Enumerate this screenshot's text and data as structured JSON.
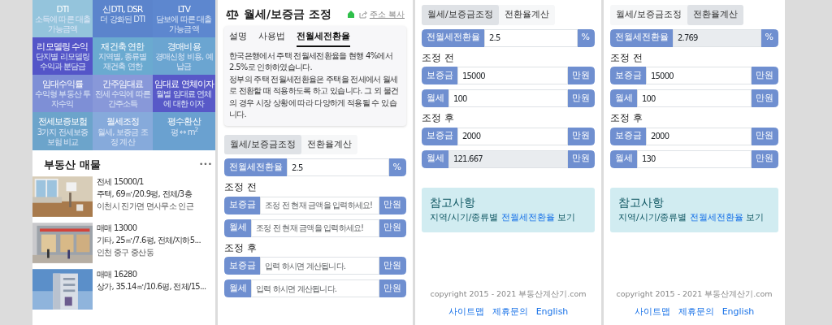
{
  "menu_panel": {
    "tiles": [
      {
        "title": "DTI",
        "desc": "소득에 따른 대출 가능금액",
        "color": "#94c4dc"
      },
      {
        "title": "신DTI, DSR",
        "desc": "더 강화된 DTI",
        "color": "#5b84cc"
      },
      {
        "title": "LTV",
        "desc": "담보에 따른 대출 가능금액",
        "color": "#5d87cf"
      },
      {
        "title": "리모델링 수익",
        "desc": "단지별 리모델링 수익과 분담금",
        "color": "#5455c8"
      },
      {
        "title": "재건축 연한",
        "desc": "지역별, 종류별 재건축 연한",
        "color": "#6aaad0"
      },
      {
        "title": "경매비용",
        "desc": "경매신청 비용, 예납금",
        "color": "#6ba5d1"
      },
      {
        "title": "임대수익률",
        "desc": "수익형 부동산 투자수익",
        "color": "#7e8fd6"
      },
      {
        "title": "간주임대료",
        "desc": "전세 수익에 따른 간주소득",
        "color": "#8898d9"
      },
      {
        "title": "임대료 연체이자",
        "desc": "월별 임대료 연체에 대한 이자",
        "color": "#5859c8"
      },
      {
        "title": "전세보증보험",
        "desc": "3가지 전세보증보험 비교",
        "color": "#6ca4cb"
      },
      {
        "title": "월세조정",
        "desc": "월세, 보증금 조정 계산",
        "color": "#86aadb"
      },
      {
        "title": "평수환산",
        "desc": "평 ↔ m$^{2}$",
        "color": "#6aa1d0"
      }
    ],
    "listings": {
      "title": "부동산 매물",
      "more": "•••",
      "items": [
        {
          "headline": "전세 15000/1",
          "details": "주택, 69㎡/20.9평, 전체/3층",
          "location": "이천시 진가면 면사무소 인근"
        },
        {
          "headline": "매매 13000",
          "details": "기타, 25㎡/7.6평, 전체/지하5...",
          "location": "인천 중구 중산동"
        },
        {
          "headline": "매매 16280",
          "details": "상가, 35.14㎡/10.6평, 전체/15..."
        }
      ]
    }
  },
  "calculators": [
    {
      "header": {
        "title": "월세/보증금 조정",
        "copy_label": "주소 복사"
      },
      "info": {
        "tabs": [
          {
            "label": "설명",
            "selected": false
          },
          {
            "label": "사용법",
            "selected": false
          },
          {
            "label": "전월세전환율",
            "selected": true
          }
        ],
        "paragraphs": [
          "한국은행에서 주택 전월세전환율을 현행 4%에서 2.5%로 인하하였습니다.",
          "정부의 주택 전월세전환율은 주택을 전세에서 월세로 전환할 때 적용하도록 하고 있습니다. 그 외 물건의 경우 시장 상황에 따라 다양하게 적용될 수 있습니다."
        ]
      },
      "modes": [
        {
          "label": "월세/보증금조정",
          "selected": true
        },
        {
          "label": "전환율계산",
          "selected": false
        }
      ],
      "rate": {
        "label": "전월세전환율",
        "value": "2.5",
        "unit": "%",
        "readonly": false
      },
      "sections": [
        {
          "heading": "조정 전",
          "fields": [
            {
              "label": "보증금",
              "placeholder": "조정 전 현재 금액을 입력하세요!",
              "unit": "만원",
              "readonly": false
            },
            {
              "label": "월세",
              "placeholder": "조정 전 현재 금액을 입력하세요!",
              "unit": "만원",
              "readonly": false
            }
          ]
        },
        {
          "heading": "조정 후",
          "fields": [
            {
              "label": "보증금",
              "placeholder": "입력 하시면 계산됩니다.",
              "unit": "만원",
              "readonly": false
            },
            {
              "label": "월세",
              "placeholder": "입력 하시면 계산됩니다.",
              "unit": "만원",
              "readonly": false
            }
          ]
        }
      ]
    },
    {
      "modes": [
        {
          "label": "월세/보증금조정",
          "selected": true
        },
        {
          "label": "전환율계산",
          "selected": false
        }
      ],
      "rate": {
        "label": "전월세전환율",
        "value": "2.5",
        "unit": "%",
        "readonly": false
      },
      "sections": [
        {
          "heading": "조정 전",
          "fields": [
            {
              "label": "보증금",
              "value": "15000",
              "unit": "만원",
              "readonly": false
            },
            {
              "label": "월세",
              "value": "100",
              "unit": "만원",
              "readonly": false
            }
          ]
        },
        {
          "heading": "조정 후",
          "fields": [
            {
              "label": "보증금",
              "value": "2000",
              "unit": "만원",
              "readonly": false
            },
            {
              "label": "월세",
              "value": "121.667",
              "unit": "만원",
              "readonly": true
            }
          ]
        }
      ],
      "notice": {
        "title": "참고사항",
        "text_before": "지역/시기/종류별 ",
        "link": "전월세전환율",
        "text_after": " 보기"
      },
      "footer": {
        "copyright": "copyright 2015 - 2021 부동산계산기.com",
        "links": [
          "사이트맵",
          "제휴문의",
          "English"
        ]
      }
    },
    {
      "modes": [
        {
          "label": "월세/보증금조정",
          "selected": false
        },
        {
          "label": "전환율계산",
          "selected": true
        }
      ],
      "rate": {
        "label": "전월세전환율",
        "value": "2.769",
        "unit": "%",
        "readonly": true
      },
      "sections": [
        {
          "heading": "조정 전",
          "fields": [
            {
              "label": "보증금",
              "value": "15000",
              "unit": "만원",
              "readonly": false
            },
            {
              "label": "월세",
              "value": "100",
              "unit": "만원",
              "readonly": false
            }
          ]
        },
        {
          "heading": "조정 후",
          "fields": [
            {
              "label": "보증금",
              "value": "2000",
              "unit": "만원",
              "readonly": false
            },
            {
              "label": "월세",
              "value": "130",
              "unit": "만원",
              "readonly": false
            }
          ]
        }
      ],
      "notice": {
        "title": "참고사항",
        "text_before": "지역/시기/종류별 ",
        "link": "전월세전환율",
        "text_after": " 보기"
      },
      "footer": {
        "copyright": "copyright 2015 - 2021 부동산계산기.com",
        "links": [
          "사이트맵",
          "제휴문의",
          "English"
        ]
      }
    }
  ]
}
